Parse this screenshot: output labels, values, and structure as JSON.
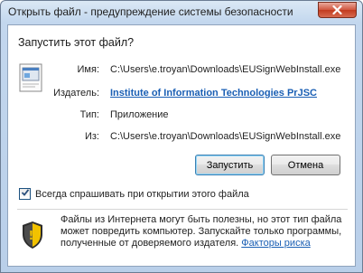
{
  "window": {
    "title": "Открыть файл - предупреждение системы безопасности",
    "close_label": "Закрыть"
  },
  "dialog": {
    "question": "Запустить этот файл?",
    "fields": {
      "name_label": "Имя:",
      "name_value": "C:\\Users\\e.troyan\\Downloads\\EUSignWebInstall.exe",
      "publisher_label": "Издатель:",
      "publisher_value": "Institute of Information Technologies PrJSC",
      "type_label": "Тип:",
      "type_value": "Приложение",
      "from_label": "Из:",
      "from_value": "C:\\Users\\e.troyan\\Downloads\\EUSignWebInstall.exe"
    },
    "buttons": {
      "run": "Запустить",
      "cancel": "Отмена"
    },
    "checkbox": {
      "label": "Всегда спрашивать при открытии этого файла",
      "checked": true
    },
    "warning": {
      "text": "Файлы из Интернета могут быть полезны, но этот тип файла может повредить компьютер. Запускайте только программы, полученные от доверяемого издателя.",
      "link": "Факторы риска"
    }
  },
  "icons": {
    "file": "executable-file-icon",
    "shield": "security-shield-icon",
    "close": "close-icon",
    "check": "check-icon"
  },
  "colors": {
    "link": "#1a5fb4",
    "close_button": "#c23b1f",
    "default_button_border": "#3c7fb1"
  }
}
